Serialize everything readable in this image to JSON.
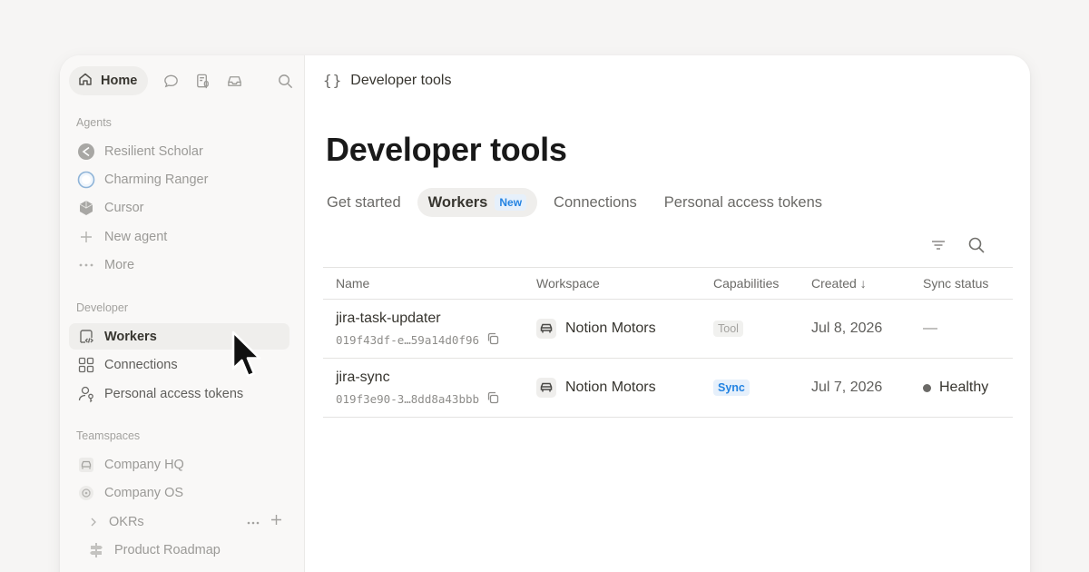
{
  "sidebar": {
    "home_label": "Home",
    "sections": {
      "agents": "Agents",
      "developer": "Developer",
      "teamspaces": "Teamspaces"
    },
    "agents": [
      {
        "label": "Resilient Scholar",
        "icon": "scholar-avatar-icon"
      },
      {
        "label": "Charming Ranger",
        "icon": "ranger-avatar-icon"
      },
      {
        "label": "Cursor",
        "icon": "cursor-app-icon"
      },
      {
        "label": "New agent",
        "icon": "plus-icon"
      },
      {
        "label": "More",
        "icon": "ellipsis-icon"
      }
    ],
    "developer": [
      {
        "label": "Workers",
        "icon": "code-page-icon",
        "active": true
      },
      {
        "label": "Connections",
        "icon": "grid-icon"
      },
      {
        "label": "Personal access tokens",
        "icon": "person-key-icon"
      }
    ],
    "teamspaces": [
      {
        "label": "Company HQ",
        "icon": "car-icon"
      },
      {
        "label": "Company OS",
        "icon": "gear-circle-icon"
      },
      {
        "label": "OKRs",
        "icon": "chevron-right-icon"
      },
      {
        "label": "Product Roadmap",
        "icon": "signpost-icon"
      }
    ]
  },
  "header": {
    "breadcrumb_icon": "{}",
    "breadcrumb": "Developer tools"
  },
  "page": {
    "title": "Developer tools",
    "tabs": [
      {
        "label": "Get started"
      },
      {
        "label": "Workers",
        "badge": "New",
        "active": true
      },
      {
        "label": "Connections"
      },
      {
        "label": "Personal access tokens"
      }
    ]
  },
  "table": {
    "columns": [
      "Name",
      "Workspace",
      "Capabilities",
      "Created ↓",
      "Sync status"
    ],
    "rows": [
      {
        "name": "jira-task-updater",
        "id": "019f43df-e…59a14d0f96",
        "workspace": "Notion Motors",
        "capability": "Tool",
        "created": "Jul 8, 2026",
        "sync_status": "—"
      },
      {
        "name": "jira-sync",
        "id": "019f3e90-3…8dd8a43bbb",
        "workspace": "Notion Motors",
        "capability": "Sync",
        "created": "Jul 7, 2026",
        "sync_status": "Healthy"
      }
    ]
  },
  "colors": {
    "accent_blue": "#2383e2",
    "background": "#f6f5f4",
    "sidebar": "#f9f8f7"
  }
}
